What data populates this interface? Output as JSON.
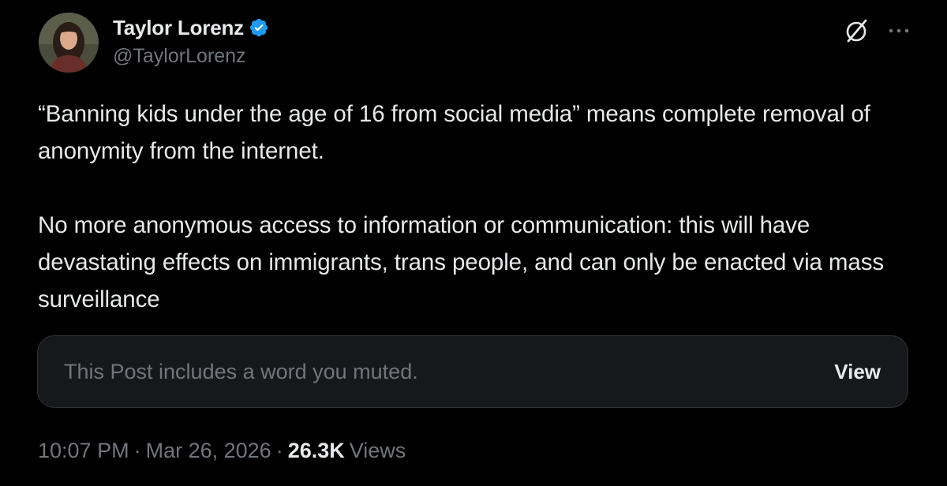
{
  "author": {
    "display_name": "Taylor Lorenz",
    "handle": "@TaylorLorenz",
    "verified": true
  },
  "post": {
    "paragraphs": [
      "“Banning kids under the age of 16 from social media” means complete removal of anonymity from the internet.",
      "No more anonymous access to information or communication: this will have devastating effects on immigrants, trans people, and can only be enacted via mass surveillance"
    ]
  },
  "muted_notice": {
    "text": "This Post includes a word you muted.",
    "action_label": "View"
  },
  "meta": {
    "time": "10:07 PM",
    "separator": "·",
    "date": "Mar 26, 2026",
    "views_count": "26.3K",
    "views_label": "Views"
  },
  "icons": {
    "verified": "verified-badge-icon",
    "grok": "grok-icon",
    "more": "more-icon"
  },
  "colors": {
    "background": "#000000",
    "text_primary": "#e7e9ea",
    "text_secondary": "#71767b",
    "verified_blue": "#1d9bf0",
    "card_background": "#16181c",
    "card_border": "#2f3336"
  }
}
